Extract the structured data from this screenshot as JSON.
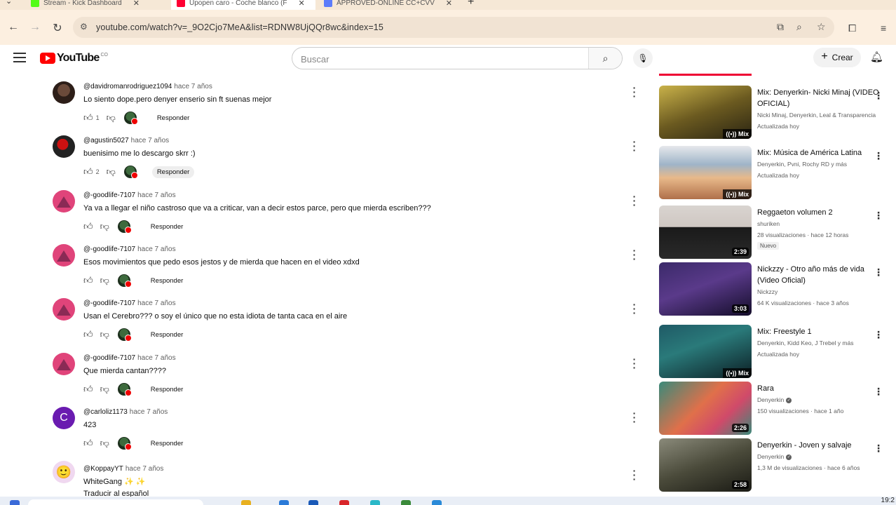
{
  "browser": {
    "tabs": [
      {
        "title": "Stream - Kick Dashboard",
        "color": "#53fc18"
      },
      {
        "title": "Upopen caro - Coche blanco (F",
        "color": "#ff0033"
      },
      {
        "title": "APPROVED-ONLINE CC+CVV",
        "color": "#5c7cfa"
      }
    ],
    "url": "youtube.com/watch?v=_9O2Cjo7MeA&list=RDNW8UjQQr8wc&index=15"
  },
  "header": {
    "logo_text": "YouTube",
    "country_code": "CO",
    "search_placeholder": "Buscar",
    "create_label": "Crear"
  },
  "comments": [
    {
      "author": "@davidromanrodriguez1094",
      "time": "hace 7 años",
      "text": "Lo siento dope.pero denyer enserio sin ft suenas mejor",
      "likes": "1",
      "reply": "Responder",
      "avatar": "av-a",
      "avatar_letter": ""
    },
    {
      "author": "@agustin5027",
      "time": "hace 7 años",
      "text": "buenisimo me lo descargo skrr :)",
      "likes": "2",
      "reply": "Responder",
      "avatar": "av-b",
      "avatar_letter": ""
    },
    {
      "author": "@-goodlife-7107",
      "time": "hace 7 años",
      "text": "Ya va a llegar el niño castroso que va a criticar, van a decir estos parce, pero que mierda escriben???",
      "likes": "",
      "reply": "Responder",
      "avatar": "av-c",
      "avatar_letter": ""
    },
    {
      "author": "@-goodlife-7107",
      "time": "hace 7 años",
      "text": "Esos movimientos que pedo  esos jestos y de mierda que hacen en el video xdxd",
      "likes": "",
      "reply": "Responder",
      "avatar": "av-c",
      "avatar_letter": ""
    },
    {
      "author": "@-goodlife-7107",
      "time": "hace 7 años",
      "text": "Usan el Cerebro??? o soy el único que no esta idiota de tanta caca en el aire",
      "likes": "",
      "reply": "Responder",
      "avatar": "av-c",
      "avatar_letter": ""
    },
    {
      "author": "@-goodlife-7107",
      "time": "hace 7 años",
      "text": "Que mierda cantan????",
      "likes": "",
      "reply": "Responder",
      "avatar": "av-c",
      "avatar_letter": ""
    },
    {
      "author": "@carloliz1173",
      "time": "hace 7 años",
      "text": "423",
      "likes": "",
      "reply": "Responder",
      "avatar": "av-d",
      "avatar_letter": "C"
    },
    {
      "author": "@KoppayYT",
      "time": "hace 7 años",
      "text": "WhiteGang ✨ ✨",
      "likes": "",
      "reply": "",
      "avatar": "av-e",
      "avatar_letter": "🙂",
      "translate": "Traducir al español"
    }
  ],
  "recommendations": [
    {
      "title": "Mix: Denyerkin- Nicki Minaj (VIDEO OFICIAL)",
      "meta1": "Nicki Minaj, Denyerkin, Leal & Transparencia",
      "meta2": "Actualizada hoy",
      "meta3": "",
      "badge": "Mix",
      "duration": "",
      "is_mix": true,
      "verified": false,
      "is_new": false,
      "thumb_colors": [
        "#c9b24a",
        "#2a2412"
      ]
    },
    {
      "title": "Mix: Música de América Latina",
      "meta1": "Denyerkin, Pvni, Rochy RD y más",
      "meta2": "Actualizada hoy",
      "meta3": "",
      "badge": "Mix",
      "duration": "",
      "is_mix": true,
      "verified": false,
      "is_new": false,
      "thumb_colors": [
        "#e8b98a",
        "#9fb4c8"
      ]
    },
    {
      "title": "Reggaeton volumen 2",
      "meta1": "shuriken",
      "meta2": "28 visualizaciones · hace 12 horas",
      "meta3": "Nuevo",
      "badge": "",
      "duration": "2:39",
      "is_mix": false,
      "verified": false,
      "is_new": true,
      "thumb_colors": [
        "#d9d4d0",
        "#1a1a1a"
      ]
    },
    {
      "title": "Nickzzy - Otro año más de vida (Video Oficial)",
      "meta1": "Nickzzy",
      "meta2": "64 K visualizaciones · hace 3 años",
      "meta3": "",
      "badge": "",
      "duration": "3:03",
      "is_mix": false,
      "verified": false,
      "is_new": false,
      "thumb_colors": [
        "#3b2a6a",
        "#140d2a"
      ]
    },
    {
      "title": "Mix: Freestyle 1",
      "meta1": "Denyerkin, Kidd Keo, J Trebel y más",
      "meta2": "Actualizada hoy",
      "meta3": "",
      "badge": "Mix",
      "duration": "",
      "is_mix": true,
      "verified": false,
      "is_new": false,
      "thumb_colors": [
        "#1f5a66",
        "#0c1e24"
      ]
    },
    {
      "title": "Rara",
      "meta1": "Denyerkin",
      "meta2": "150 visualizaciones · hace 1 año",
      "meta3": "",
      "badge": "",
      "duration": "2:26",
      "is_mix": false,
      "verified": true,
      "is_new": false,
      "thumb_colors": [
        "#e0704a",
        "#3a8a7a"
      ]
    },
    {
      "title": "Denyerkin - Joven y salvaje",
      "meta1": "Denyerkin",
      "meta2": "1,3 M de visualizaciones · hace 6 años",
      "meta3": "",
      "badge": "",
      "duration": "2:58",
      "is_mix": false,
      "verified": true,
      "is_new": false,
      "thumb_colors": [
        "#6a6a5a",
        "#1a1a14"
      ]
    }
  ],
  "taskbar": {
    "clock": "19:2"
  },
  "colors": {
    "accent": "#ff0033",
    "chrome_bg": "#fcefe0"
  }
}
